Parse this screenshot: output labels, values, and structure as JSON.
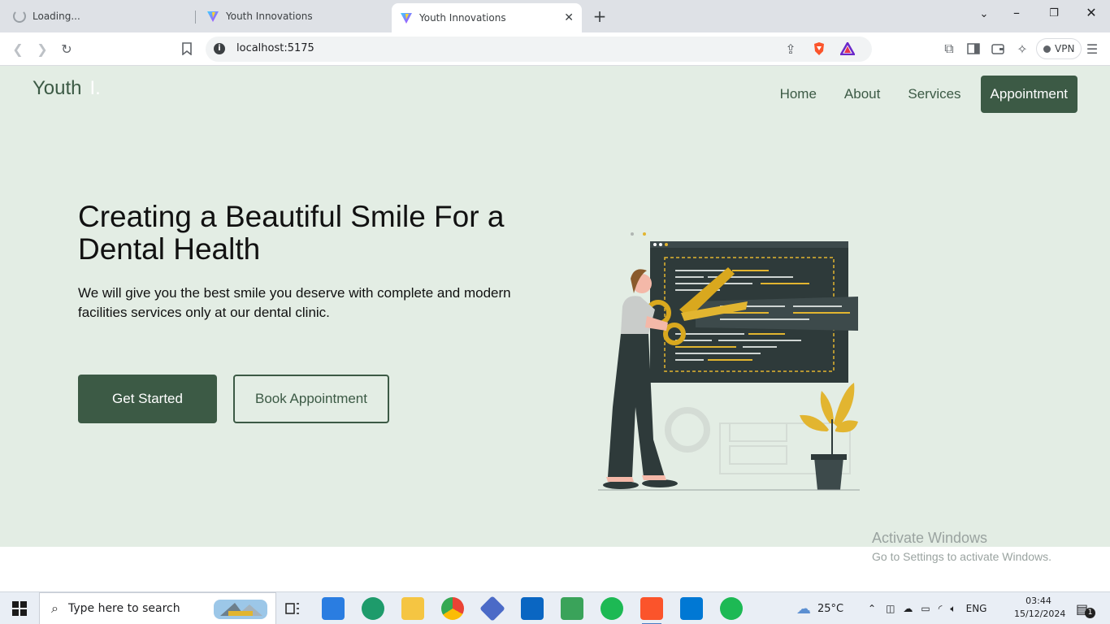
{
  "browser": {
    "tabs": [
      {
        "title": "Loading...",
        "state": "loading"
      },
      {
        "title": "Youth Innovations",
        "state": "inactive"
      },
      {
        "title": "Youth Innovations",
        "state": "active"
      }
    ],
    "url": "localhost:5175",
    "vpn_label": "VPN"
  },
  "site": {
    "logo_text": "Youth",
    "logo_mark": "I.",
    "nav": {
      "home": "Home",
      "about": "About",
      "services": "Services",
      "appointment": "Appointment"
    },
    "hero": {
      "title": "Creating a Beautiful Smile For a Dental Health",
      "subtitle": "We will give you the best smile you deserve with complete and modern facilities services only at our dental clinic.",
      "primary_button": "Get Started",
      "secondary_button": "Book Appointment"
    },
    "colors": {
      "background": "#e3ede4",
      "brand_green": "#3c5a45",
      "accent_yellow": "#e2b530"
    }
  },
  "os": {
    "activation_title": "Activate Windows",
    "activation_sub": "Go to Settings to activate Windows.",
    "taskbar": {
      "search_placeholder": "Type here to search",
      "weather": "25°C",
      "language": "ENG",
      "time": "03:44",
      "date": "15/12/2024",
      "notification_count": "1"
    }
  }
}
